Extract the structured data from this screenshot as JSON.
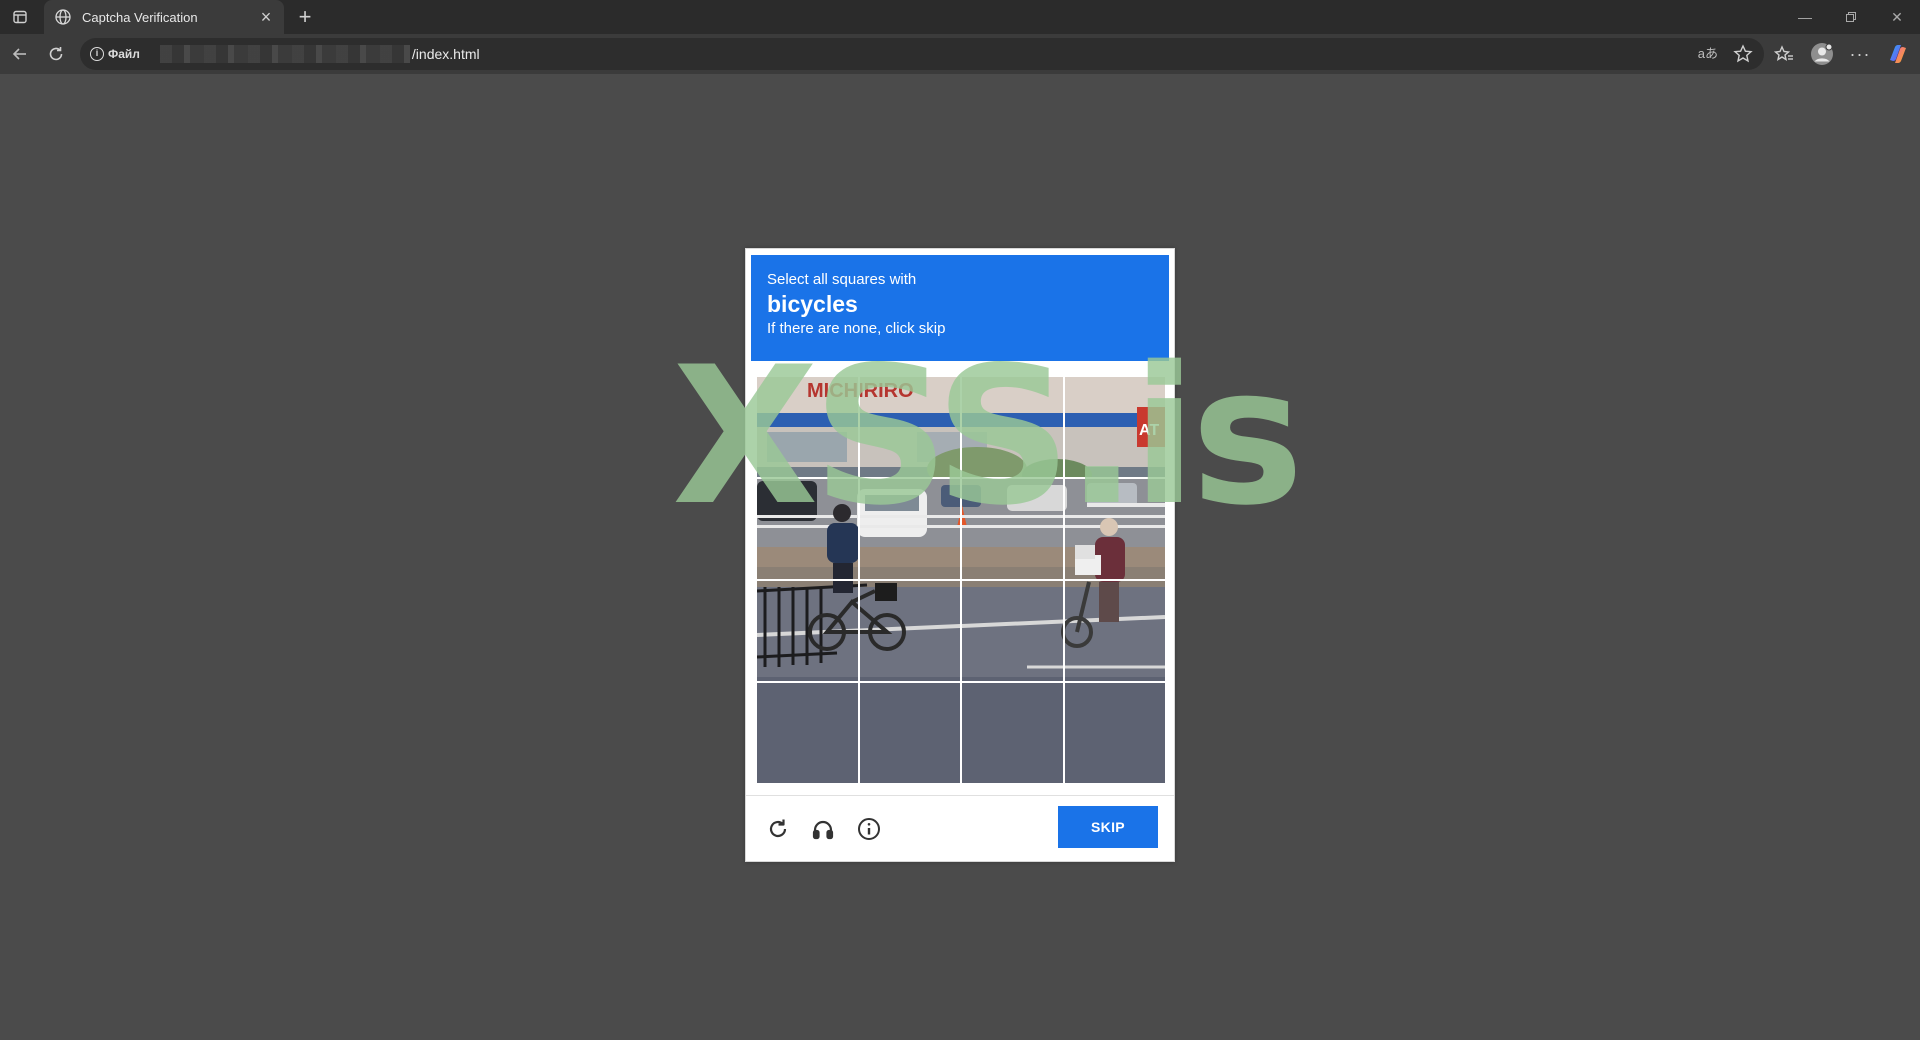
{
  "browser": {
    "tab": {
      "title": "Captcha Verification"
    },
    "address": {
      "site_info_label": "Файл",
      "url_path": "/index.html"
    }
  },
  "captcha": {
    "header": {
      "line1": "Select all squares with",
      "keyword": "bicycles",
      "line3": "If there are none, click skip"
    },
    "grid": {
      "rows": 4,
      "cols": 4
    },
    "footer": {
      "skip_label": "SKIP",
      "icons": [
        "reload-icon",
        "audio-headphones-icon",
        "info-icon"
      ]
    },
    "colors": {
      "accent": "#1a73e8"
    }
  },
  "watermark": {
    "text": "XSS.is"
  }
}
